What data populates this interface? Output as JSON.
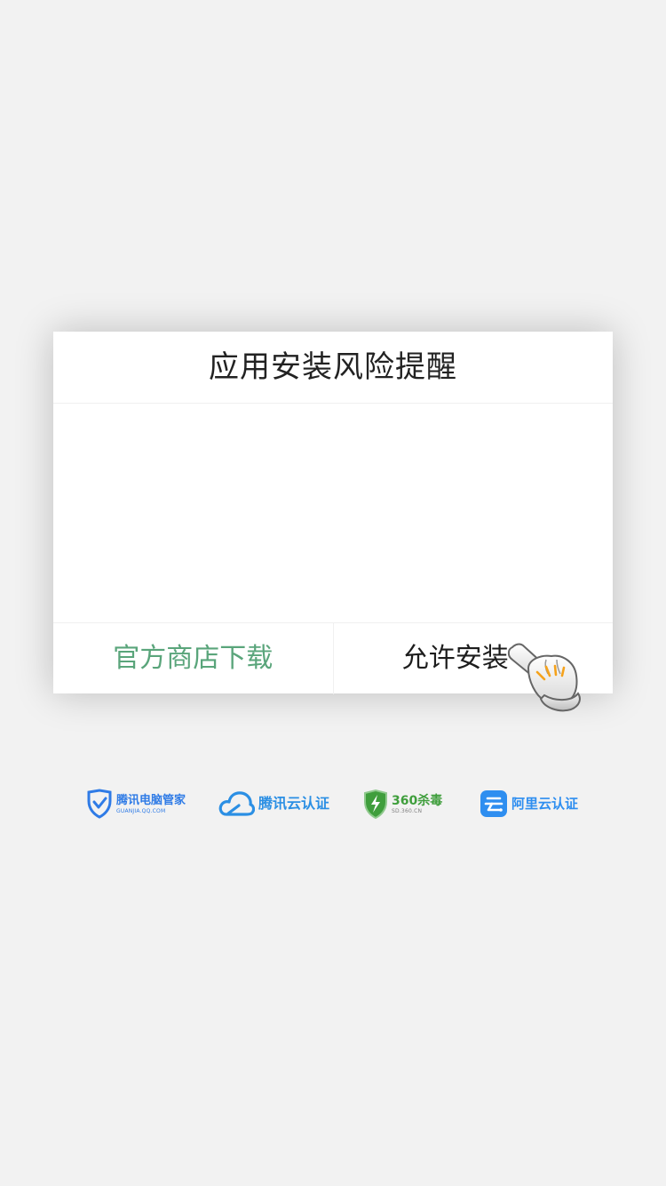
{
  "dialog": {
    "title": "应用安装风险提醒",
    "official_store_label": "官方商店下载",
    "allow_install_label": "允许安装"
  },
  "badges": {
    "tencent_guanjia": {
      "name": "腾讯电脑管家",
      "sub": "GUANJIA.QQ.COM"
    },
    "tencent_cloud": {
      "name": "腾讯云认证"
    },
    "sd360": {
      "name": "360杀毒",
      "sub": "SD.360.CN"
    },
    "aliyun": {
      "name": "阿里云认证"
    }
  },
  "colors": {
    "background": "#f2f2f2",
    "official_store_text": "#5aa57b",
    "tencent_blue": "#2f7be6",
    "cloud_blue": "#2b8fe4",
    "green_360": "#3f9e3c",
    "aliyun_blue": "#2e8ef0"
  },
  "icons": {
    "pointer": "pointing-hand-icon",
    "tencent_guanjia": "shield-check-icon",
    "tencent_cloud": "cloud-icon",
    "sd360": "shield-bolt-icon",
    "aliyun": "aliyun-logo-icon"
  }
}
